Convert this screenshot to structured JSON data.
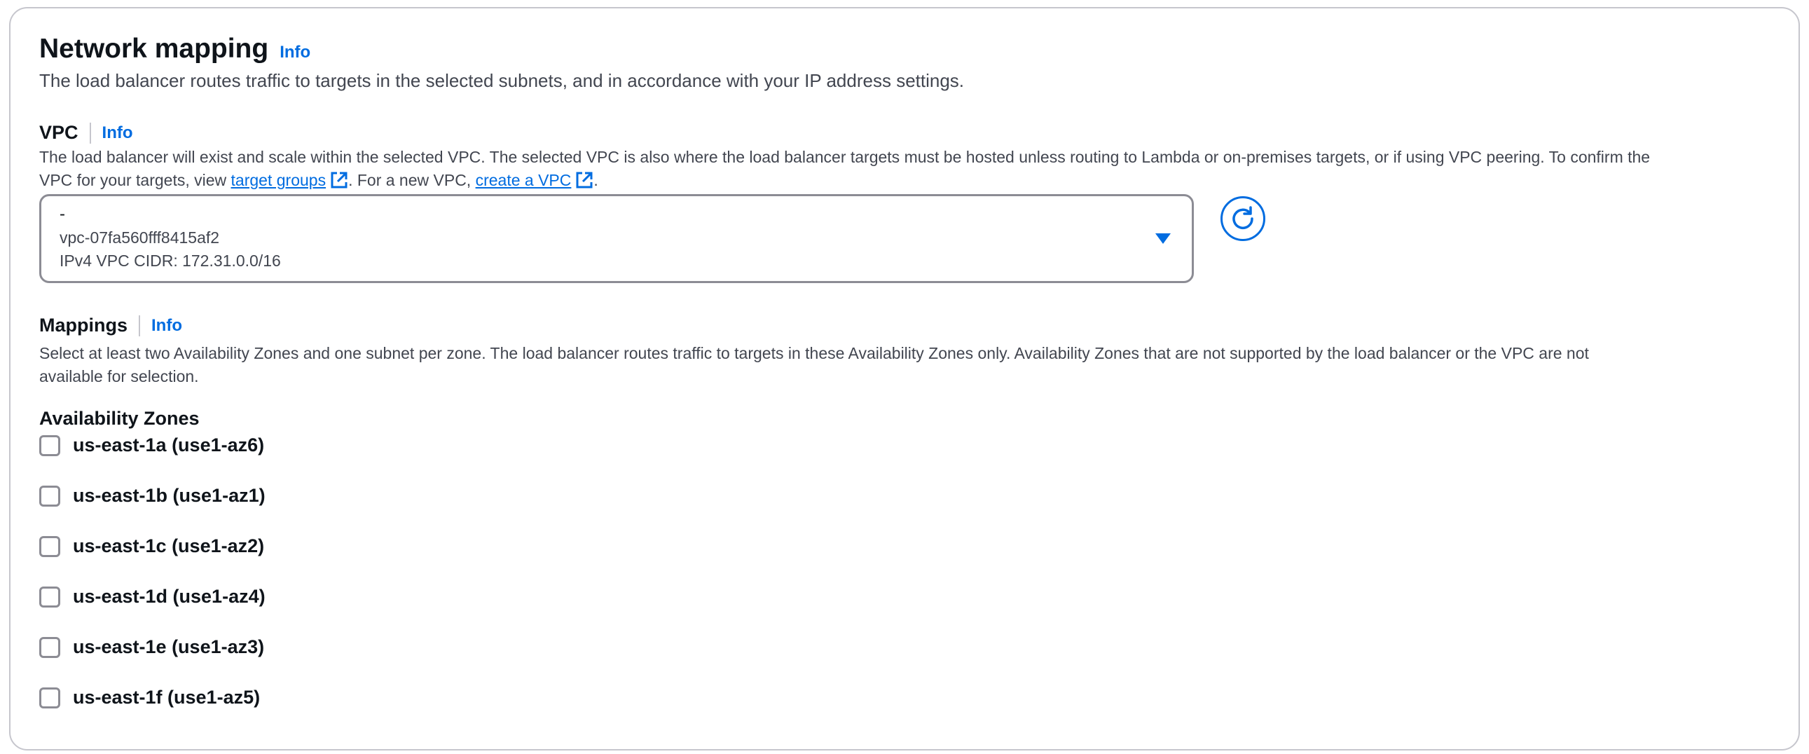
{
  "section": {
    "title": "Network mapping",
    "info_label": "Info",
    "description": "The load balancer routes traffic to targets in the selected subnets, and in accordance with your IP address settings."
  },
  "vpc": {
    "label": "VPC",
    "info_label": "Info",
    "description_line1": "The load balancer will exist and scale within the selected VPC. The selected VPC is also where the load balancer targets must be hosted unless routing to Lambda or on-premises targets, or if using VPC peering. To confirm the",
    "description_line2_prefix": "VPC for your targets, view ",
    "target_groups_link": "target groups",
    "description_line2_middle": ". For a new VPC, ",
    "create_vpc_link": "create a VPC",
    "description_line2_suffix": ".",
    "selected": {
      "name": "-",
      "id": "vpc-07fa560fff8415af2",
      "cidr": "IPv4 VPC CIDR: 172.31.0.0/16"
    },
    "caret_icon": "caret-down-icon",
    "refresh_icon": "refresh-icon",
    "external_link_icon": "external-link-icon"
  },
  "mappings": {
    "label": "Mappings",
    "info_label": "Info",
    "description_line1": "Select at least two Availability Zones and one subnet per zone. The load balancer routes traffic to targets in these Availability Zones only. Availability Zones that are not supported by the load balancer or the VPC are not",
    "description_line2": "available for selection.",
    "az_heading": "Availability Zones",
    "zones": [
      {
        "label": "us-east-1a (use1-az6)",
        "checked": false
      },
      {
        "label": "us-east-1b (use1-az1)",
        "checked": false
      },
      {
        "label": "us-east-1c (use1-az2)",
        "checked": false
      },
      {
        "label": "us-east-1d (use1-az4)",
        "checked": false
      },
      {
        "label": "us-east-1e (use1-az3)",
        "checked": false
      },
      {
        "label": "us-east-1f (use1-az5)",
        "checked": false
      }
    ]
  },
  "colors": {
    "link": "#006ce0",
    "text": "#0f141a",
    "secondary_text": "#424650",
    "border": "#8c8c94"
  }
}
